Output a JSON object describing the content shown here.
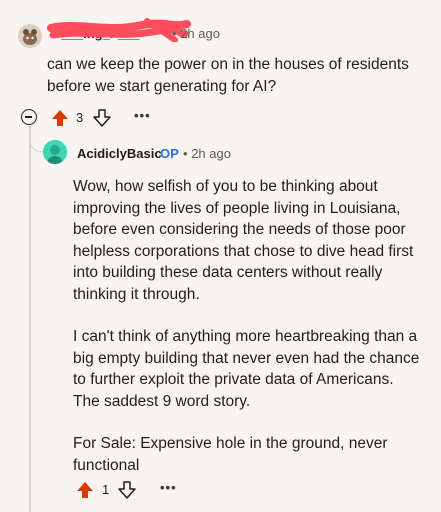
{
  "parent_comment": {
    "username": "D___ing_F___",
    "separator": "•",
    "time": "2h ago",
    "body": "can we keep the power on in the houses of residents before we start generating for AI?",
    "upvotes": "3",
    "more": "•••"
  },
  "reply": {
    "username": "AcidiclyBasic",
    "op_badge": "OP",
    "separator": "•",
    "time": "2h ago",
    "paragraphs": [
      "Wow, how selfish of you to be thinking about improving the lives of people living in Louisiana, before even considering the needs of those poor helpless corporations that chose to dive head first into building these data centers without really thinking it through.",
      "I can't think of anything more heartbreaking than a big empty building that never even had the chance to further exploit the private data of Americans. The saddest 9 word story.",
      "For Sale: Expensive hole in the ground, never functional"
    ],
    "upvotes": "1",
    "more": "•••"
  },
  "colors": {
    "background": "#f8f4f1",
    "upvote_active": "#d93a00",
    "op_badge": "#2f6fd6",
    "reply_avatar": "#3ed6b0",
    "redaction": "#ff4d5e"
  },
  "icons": [
    "collapse-icon",
    "upvote-icon",
    "downvote-icon",
    "more-icon"
  ]
}
